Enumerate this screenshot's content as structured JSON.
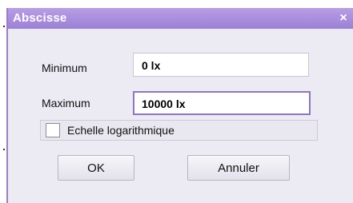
{
  "dialog": {
    "title": "Abscisse",
    "close_glyph": "×"
  },
  "fields": {
    "minimum_label": "Minimum",
    "minimum_value": "0 lx",
    "maximum_label": "Maximum",
    "maximum_value": "10000 lx"
  },
  "options": {
    "log_scale_label": "Echelle logarithmique",
    "log_scale_checked": false
  },
  "buttons": {
    "ok_label": "OK",
    "cancel_label": "Annuler"
  },
  "colors": {
    "titlebar": "#a88bdc",
    "focus_border": "#8f74c8",
    "dialog_bg": "#eceaf3"
  }
}
